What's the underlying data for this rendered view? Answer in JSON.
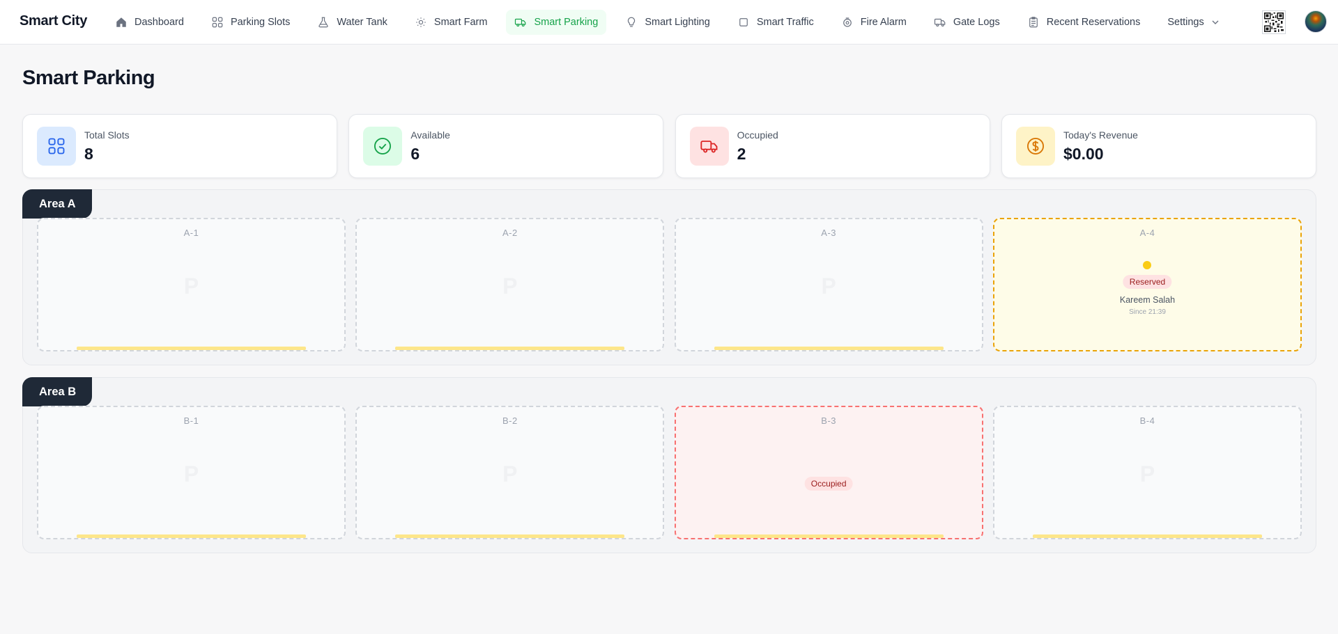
{
  "app": {
    "brand": "Smart City"
  },
  "nav": {
    "items": [
      {
        "label": "Dashboard",
        "icon": "home-icon"
      },
      {
        "label": "Parking Slots",
        "icon": "grid-icon"
      },
      {
        "label": "Water Tank",
        "icon": "flask-icon"
      },
      {
        "label": "Smart Farm",
        "icon": "sun-icon"
      },
      {
        "label": "Smart Parking",
        "icon": "truck-icon",
        "active": true
      },
      {
        "label": "Smart Lighting",
        "icon": "bulb-icon"
      },
      {
        "label": "Smart Traffic",
        "icon": "square-icon"
      },
      {
        "label": "Fire Alarm",
        "icon": "fire-alarm-icon"
      },
      {
        "label": "Gate Logs",
        "icon": "truck-icon"
      },
      {
        "label": "Recent Reservations",
        "icon": "clipboard-icon"
      },
      {
        "label": "Settings",
        "icon": "chevron-down-icon"
      }
    ]
  },
  "page": {
    "title": "Smart Parking"
  },
  "stats": [
    {
      "label": "Total Slots",
      "value": "8",
      "icon": "grid-icon",
      "bg": "#dbeafe",
      "fg": "#2563eb"
    },
    {
      "label": "Available",
      "value": "6",
      "icon": "check-circle-icon",
      "bg": "#dcfce7",
      "fg": "#16a34a"
    },
    {
      "label": "Occupied",
      "value": "2",
      "icon": "truck-icon",
      "bg": "#fee2e2",
      "fg": "#dc2626"
    },
    {
      "label": "Today's Revenue",
      "value": "$0.00",
      "icon": "dollar-circle-icon",
      "bg": "#fef3c7",
      "fg": "#d97706"
    }
  ],
  "areas": [
    {
      "name": "Area A",
      "slots": [
        {
          "id": "A-1",
          "status": "available",
          "mark": "P"
        },
        {
          "id": "A-2",
          "status": "available",
          "mark": "P"
        },
        {
          "id": "A-3",
          "status": "available",
          "mark": "P"
        },
        {
          "id": "A-4",
          "status": "reserved",
          "badge": "Reserved",
          "person": "Kareem Salah",
          "since": "Since 21:39"
        }
      ]
    },
    {
      "name": "Area B",
      "slots": [
        {
          "id": "B-1",
          "status": "available",
          "mark": "P"
        },
        {
          "id": "B-2",
          "status": "available",
          "mark": "P"
        },
        {
          "id": "B-3",
          "status": "occupied",
          "badge": "Occupied"
        },
        {
          "id": "B-4",
          "status": "available",
          "mark": "P"
        }
      ]
    }
  ]
}
